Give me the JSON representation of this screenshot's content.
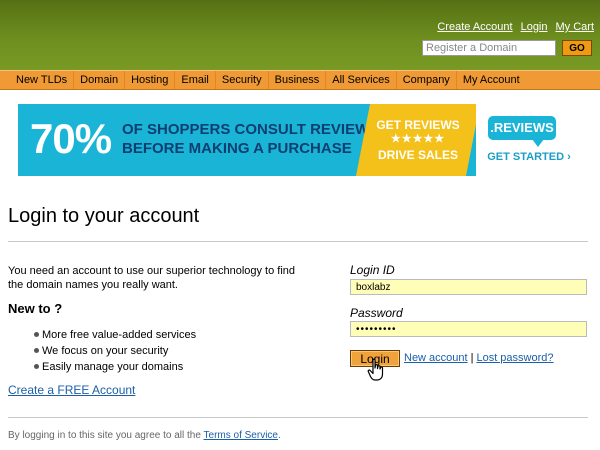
{
  "header": {
    "links": [
      "Create Account",
      "Login",
      "My Cart"
    ],
    "domain_placeholder": "Register a Domain",
    "go_label": "GO"
  },
  "nav": {
    "items": [
      "New TLDs",
      "Domain",
      "Hosting",
      "Email",
      "Security",
      "Business",
      "All Services",
      "Company",
      "My Account"
    ]
  },
  "banner": {
    "percent": "70%",
    "line1": "OF SHOPPERS CONSULT REVIEWS",
    "line2": "BEFORE MAKING A PURCHASE",
    "yellow_line1": "GET REVIEWS",
    "stars": "★★★★★",
    "yellow_line2": "DRIVE SALES",
    "logo": ".REVIEWS",
    "cta": "GET STARTED ›"
  },
  "main": {
    "title": "Login to your account",
    "intro": "You need an account to use our superior technology to find the domain names you really want.",
    "new_to": "New to ?",
    "features": [
      "More free value-added services",
      "We focus on your security",
      "Easily manage your domains"
    ],
    "create_link": "Create a FREE Account"
  },
  "login_form": {
    "login_label": "Login ID",
    "login_value": "boxlabz",
    "password_label": "Password",
    "password_value": "•••••••••",
    "login_button": "Login",
    "new_account": "New account",
    "separator": "|",
    "lost_password": "Lost password?"
  },
  "footer": {
    "terms_prefix": "By logging in to this site you agree to all the",
    "terms_link": "Terms of Service",
    "terms_suffix": "."
  },
  "colors": {
    "header_green": "#6b8a1e",
    "nav_orange": "#ef9a35",
    "input_yellow": "#fffeb8",
    "link_blue": "#1a5fa8",
    "banner_blue": "#1ab4d7",
    "banner_yellow": "#f4c01a"
  }
}
